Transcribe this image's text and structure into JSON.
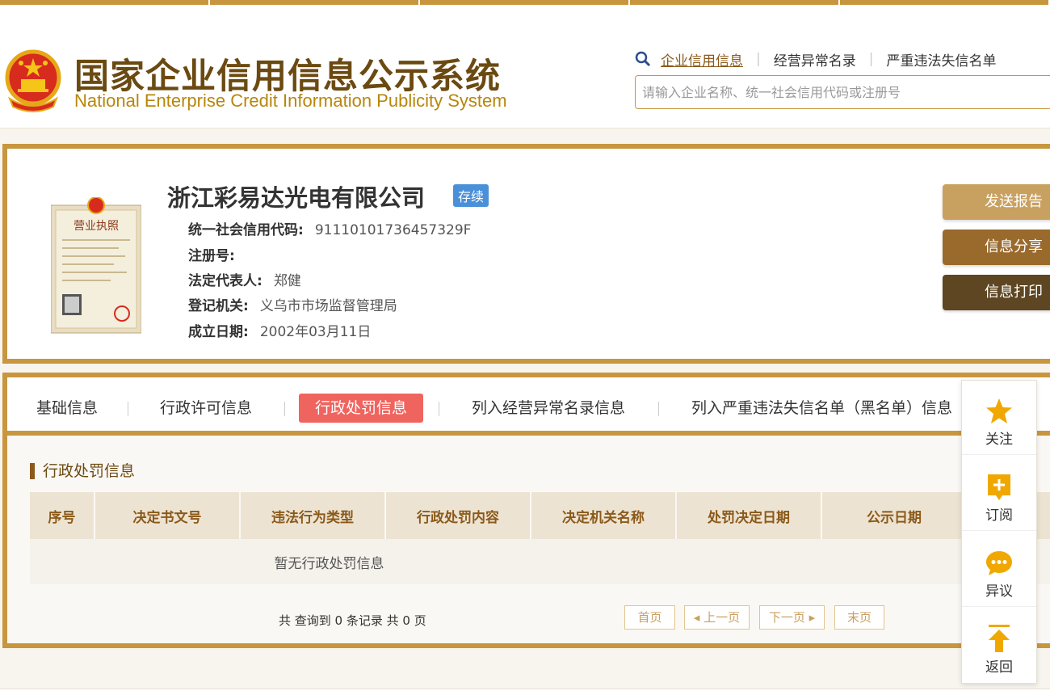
{
  "header": {
    "title_cn": "国家企业信用信息公示系统",
    "title_en": "National Enterprise Credit Information Publicity System",
    "search_tabs": [
      "企业信用信息",
      "经营异常名录",
      "严重违法失信名单"
    ],
    "search_placeholder": "请输入企业名称、统一社会信用代码或注册号"
  },
  "company": {
    "name": "浙江彩易达光电有限公司",
    "status": "存续",
    "fields": [
      {
        "label": "统一社会信用代码:",
        "value": "91110101736457329F"
      },
      {
        "label": "注册号:",
        "value": ""
      },
      {
        "label": "法定代表人:",
        "value": "郑健"
      },
      {
        "label": "登记机关:",
        "value": "义乌市市场监督管理局"
      },
      {
        "label": "成立日期:",
        "value": "2002年03月11日"
      }
    ],
    "license_text": "营业执照"
  },
  "actions": [
    "发送报告",
    "信息分享",
    "信息打印"
  ],
  "colors": {
    "gold": "#c8963e",
    "action_1": "#c8a060",
    "action_2": "#9a6a2c",
    "action_3": "#5e4622",
    "active_tab": "#f0645f",
    "status_badge": "#4a90d9"
  },
  "tabs": [
    {
      "label": "基础信息",
      "active": false
    },
    {
      "label": "行政许可信息",
      "active": false
    },
    {
      "label": "行政处罚信息",
      "active": true
    },
    {
      "label": "列入经营异常名录信息",
      "active": false
    },
    {
      "label": "列入严重违法失信名单（黑名单）信息",
      "active": false
    }
  ],
  "section": {
    "title": "行政处罚信息",
    "columns": [
      "序号",
      "决定书文号",
      "违法行为类型",
      "行政处罚内容",
      "决定机关名称",
      "处罚决定日期",
      "公示日期"
    ],
    "empty_text": "暂无行政处罚信息"
  },
  "pagination": {
    "summary": "共 查询到 0 条记录 共 0 页",
    "first": "首页",
    "prev": "上一页",
    "next": "下一页",
    "last": "末页"
  },
  "sidebar": {
    "follow": "关注",
    "subscribe": "订阅",
    "objection": "异议",
    "back": "返回"
  }
}
